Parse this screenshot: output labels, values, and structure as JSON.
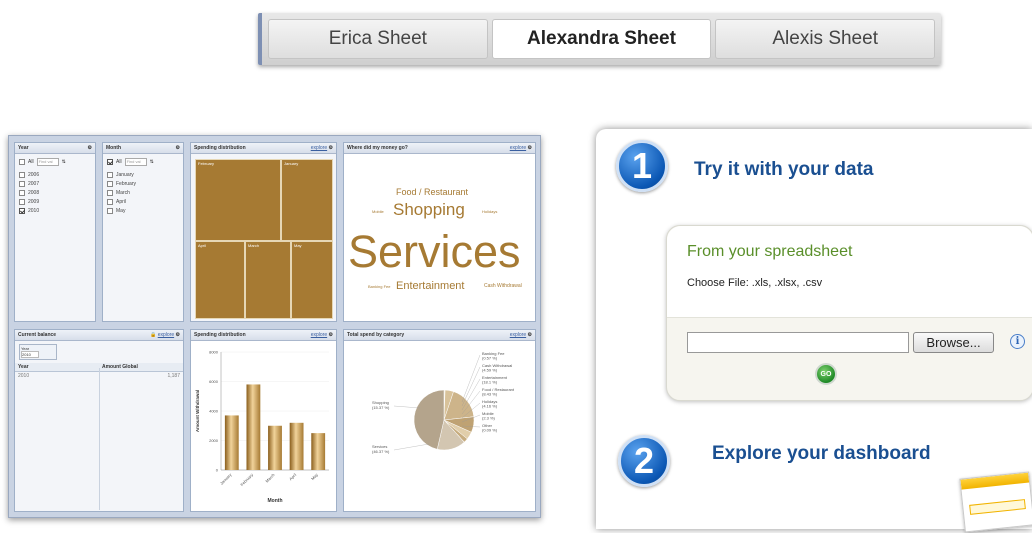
{
  "sheet_tabs": {
    "items": [
      {
        "label": "Erica Sheet",
        "active": false
      },
      {
        "label": "Alexandra Sheet",
        "active": true
      },
      {
        "label": "Alexis Sheet",
        "active": false
      }
    ]
  },
  "dashboard": {
    "year_panel": {
      "title": "Year",
      "all_label": "All",
      "search_placeholder": "Find val",
      "options": [
        {
          "label": "2006",
          "checked": false
        },
        {
          "label": "2007",
          "checked": false
        },
        {
          "label": "2008",
          "checked": false
        },
        {
          "label": "2009",
          "checked": false
        },
        {
          "label": "2010",
          "checked": true
        }
      ]
    },
    "month_panel": {
      "title": "Month",
      "all_label": "All",
      "search_placeholder": "Find val",
      "options": [
        {
          "label": "January",
          "checked": false
        },
        {
          "label": "February",
          "checked": false
        },
        {
          "label": "March",
          "checked": false
        },
        {
          "label": "April",
          "checked": false
        },
        {
          "label": "May",
          "checked": false
        }
      ]
    },
    "spending_treemap": {
      "title": "Spending distribution",
      "explore": "explore",
      "cells": [
        "February",
        "January",
        "April",
        "March",
        "May"
      ]
    },
    "word_cloud": {
      "title": "Where did my money go?",
      "explore": "explore",
      "words": {
        "food": "Food / Restaurant",
        "shopping": "Shopping",
        "services": "Services",
        "entertainment": "Entertainment",
        "holidays": "Holidays",
        "cash": "Cash Withdrawal",
        "mobile": "Mobile",
        "banking": "Banking Fee"
      }
    },
    "balance_panel": {
      "title": "Current balance",
      "explore": "explore",
      "filter_label": "Year",
      "filter_value": "2010",
      "columns": [
        "Year",
        "Amount Global"
      ],
      "rows": [
        [
          "2010",
          "1,187"
        ]
      ]
    },
    "spending_bar": {
      "title": "Spending distribution",
      "explore": "explore",
      "xlabel": "Month",
      "ylabel": "Amount Withdrawal"
    },
    "category_pie": {
      "title": "Total spend by category",
      "explore": "explore"
    }
  },
  "chart_data": [
    {
      "type": "bar",
      "title": "Spending distribution",
      "xlabel": "Month",
      "ylabel": "Amount Withdrawal",
      "categories": [
        "January",
        "February",
        "March",
        "April",
        "May"
      ],
      "values": [
        3700,
        5800,
        3000,
        3200,
        2500
      ],
      "ylim": [
        0,
        8000
      ],
      "yticks": [
        "0",
        "2000",
        "4000",
        "6000",
        "8000"
      ]
    },
    {
      "type": "pie",
      "title": "Total spend by category",
      "slices": [
        {
          "label": "Banking Fee",
          "pct": "(0.57 %)",
          "value": 0.57
        },
        {
          "label": "Cash Withdrawal",
          "pct": "(4.59 %)",
          "value": 4.59
        },
        {
          "label": "Entertainment",
          "pct": "(18.1 %)",
          "value": 18.1
        },
        {
          "label": "Food / Restaurant",
          "pct": "(8.43 %)",
          "value": 8.43
        },
        {
          "label": "Holidays",
          "pct": "(4.16 %)",
          "value": 4.16
        },
        {
          "label": "Mobile",
          "pct": "(2.3 %)",
          "value": 2.3
        },
        {
          "label": "Other",
          "pct": "(0.09 %)",
          "value": 0.09
        },
        {
          "label": "Shopping",
          "pct": "(15.37 %)",
          "value": 15.37
        },
        {
          "label": "Services",
          "pct": "(46.37 %)",
          "value": 46.37
        }
      ]
    }
  ],
  "try_it": {
    "step1_number": "1",
    "step1_title": "Try it with your data",
    "from_title": "From your spreadsheet",
    "choose_file": "Choose File: .xls, .xlsx, .csv",
    "file_value": "",
    "browse_label": "Browse...",
    "info_glyph": "i",
    "go_label": "GO",
    "step2_number": "2",
    "step2_title": "Explore your dashboard"
  }
}
